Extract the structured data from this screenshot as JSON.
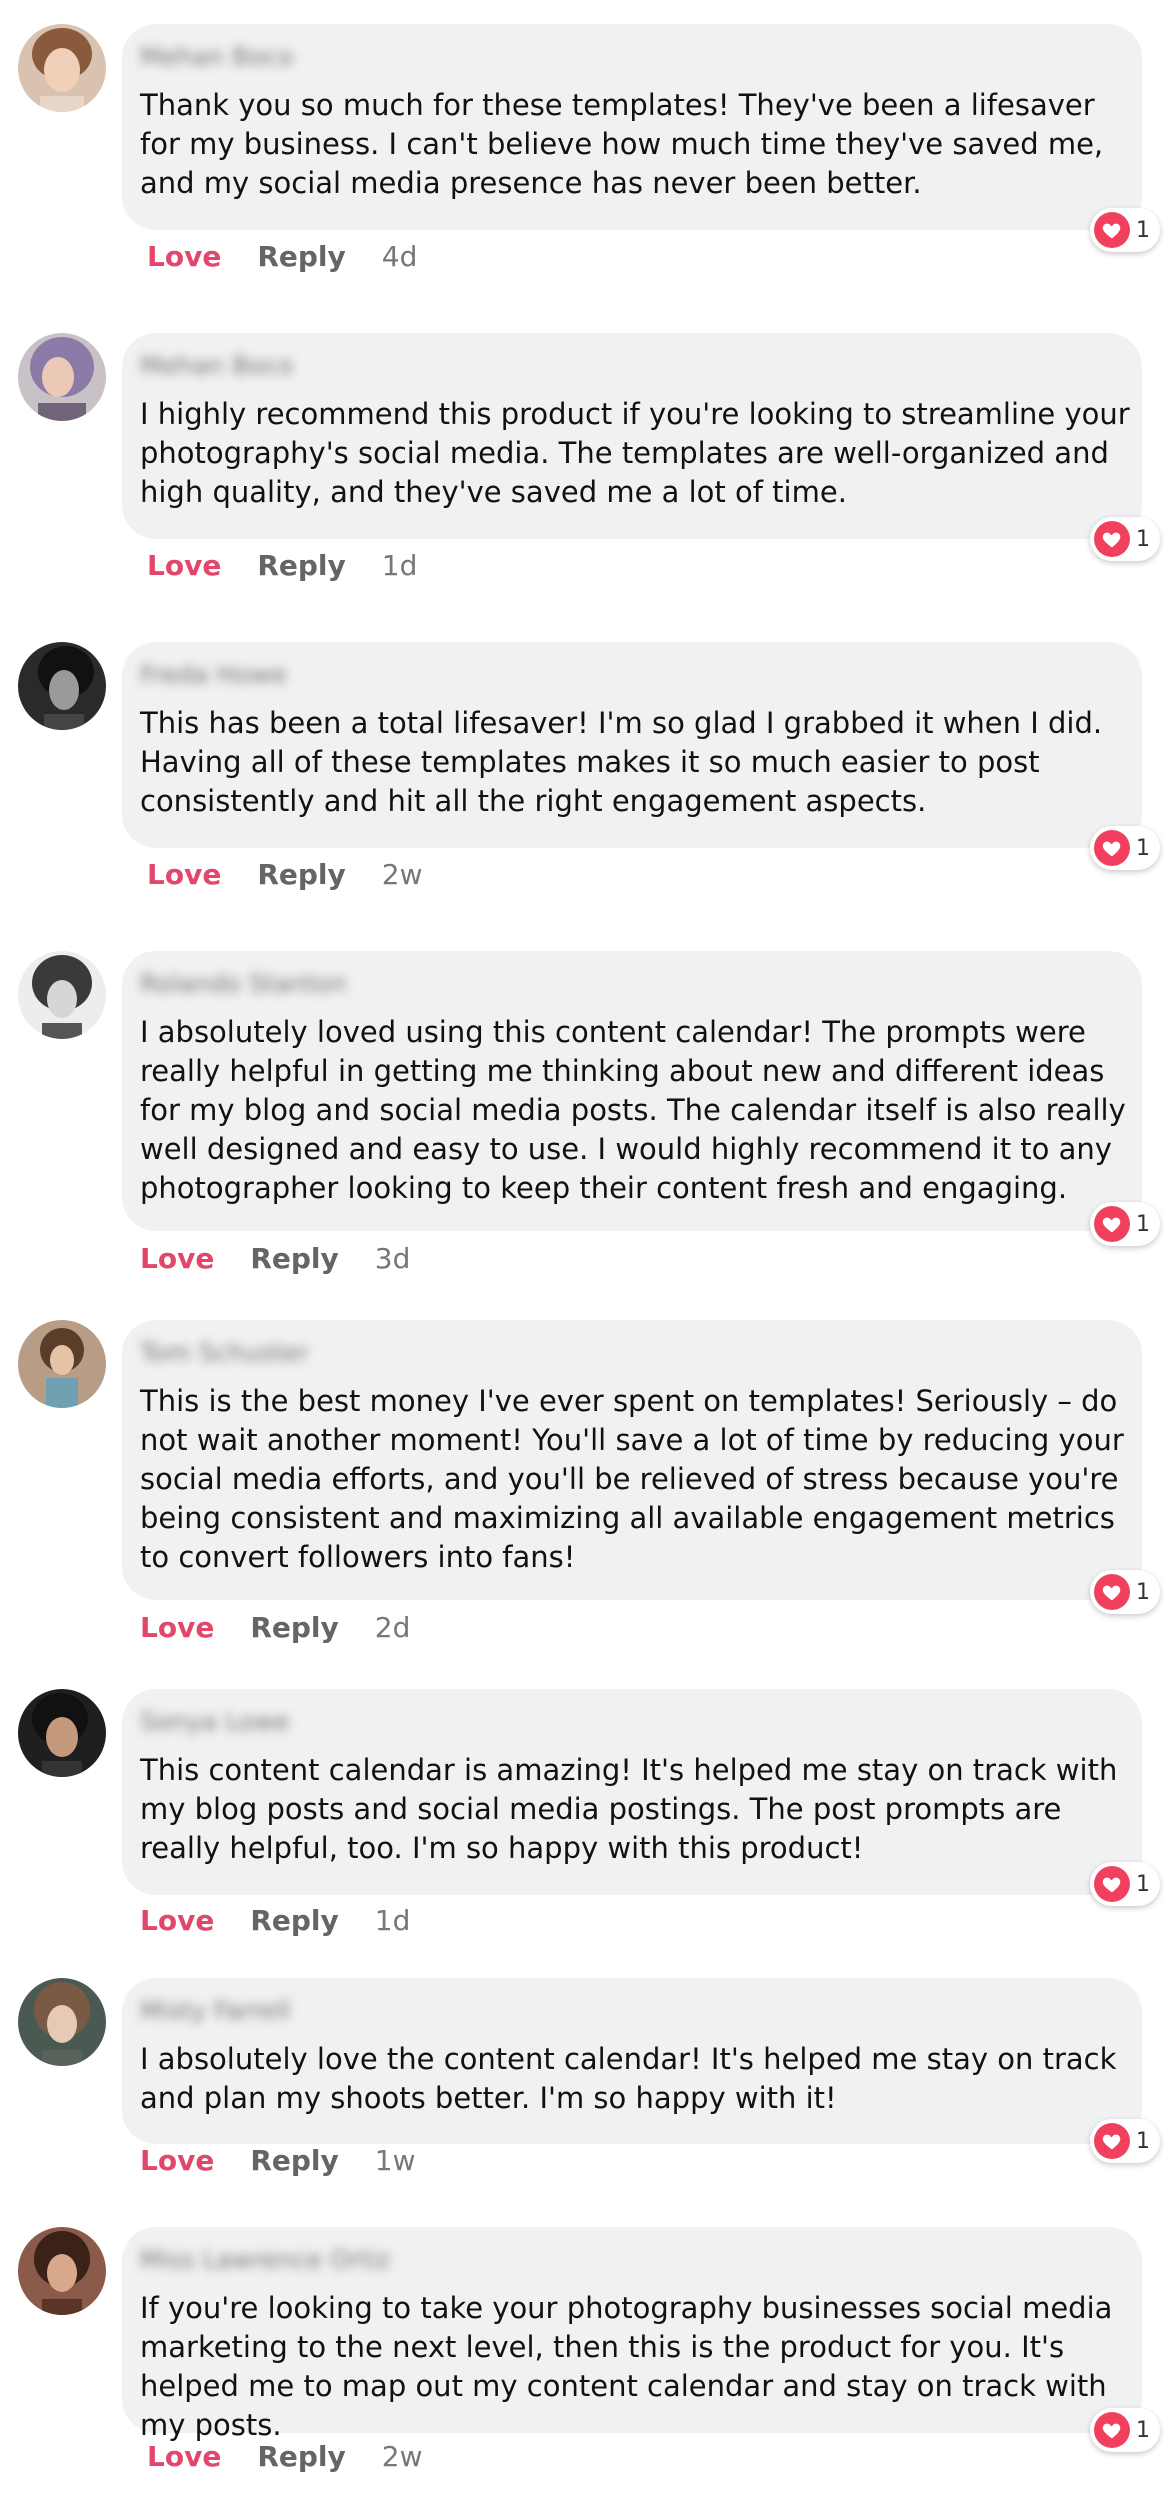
{
  "colors": {
    "love": "#e2466a",
    "bubble": "#f0f1f3",
    "heart": "#f0405d"
  },
  "comments": [
    {
      "name": "Mehan Boco",
      "text": "Thank you so much for these templates! They've been a lifesaver for my business. I can't believe how much time they've saved me, and my social media presence has never been better.",
      "love": "Love",
      "reply": "Reply",
      "time": "4d",
      "reactions": "1"
    },
    {
      "name": "Mehan Boco",
      "text": "I highly recommend this product if you're looking to streamline your photography's social media. The templates are well-organized and high quality, and they've saved me a lot of time.",
      "love": "Love",
      "reply": "Reply",
      "time": "1d",
      "reactions": "1"
    },
    {
      "name": "Freda Howe",
      "text": "This has been a total lifesaver! I'm so glad I grabbed it when I did. Having all of these templates makes it so much easier to post consistently and hit all the right engagement aspects.",
      "love": "Love",
      "reply": "Reply",
      "time": "2w",
      "reactions": "1"
    },
    {
      "name": "Rolando Stanton",
      "text": "I absolutely loved using this content calendar! The prompts were really helpful in getting me thinking about new and different ideas for my blog and social media posts. The calendar itself is also really well designed and easy to use. I would highly recommend it to any photographer looking to keep their content fresh and engaging.",
      "love": "Love",
      "reply": "Reply",
      "time": "3d",
      "reactions": "1"
    },
    {
      "name": "Tom Schuster",
      "text": "This is the best money I've ever spent on templates! Seriously – do not wait another moment! You'll save a lot of time by reducing your social media efforts, and you'll be relieved of stress because you're being consistent and maximizing all available engagement metrics to convert followers into fans!",
      "love": "Love",
      "reply": "Reply",
      "time": "2d",
      "reactions": "1"
    },
    {
      "name": "Sonya Lowe",
      "text": "This content calendar is amazing! It's helped me stay on track with my blog posts and social media postings. The post prompts are really helpful, too. I'm so happy with this product!",
      "love": "Love",
      "reply": "Reply",
      "time": "1d",
      "reactions": "1"
    },
    {
      "name": "Misty Farrell",
      "text": "I absolutely love the content calendar! It's helped me stay on track and plan my shoots better. I'm so happy with it!",
      "love": "Love",
      "reply": "Reply",
      "time": "1w",
      "reactions": "1"
    },
    {
      "name": "Miss Lawrence Ortiz",
      "text": "If you're looking to take your photography businesses social media marketing to the next level, then this is the product for you. It's helped me to map out my content calendar and stay on track with my posts.",
      "love": "Love",
      "reply": "Reply",
      "time": "2w",
      "reactions": "1"
    }
  ]
}
